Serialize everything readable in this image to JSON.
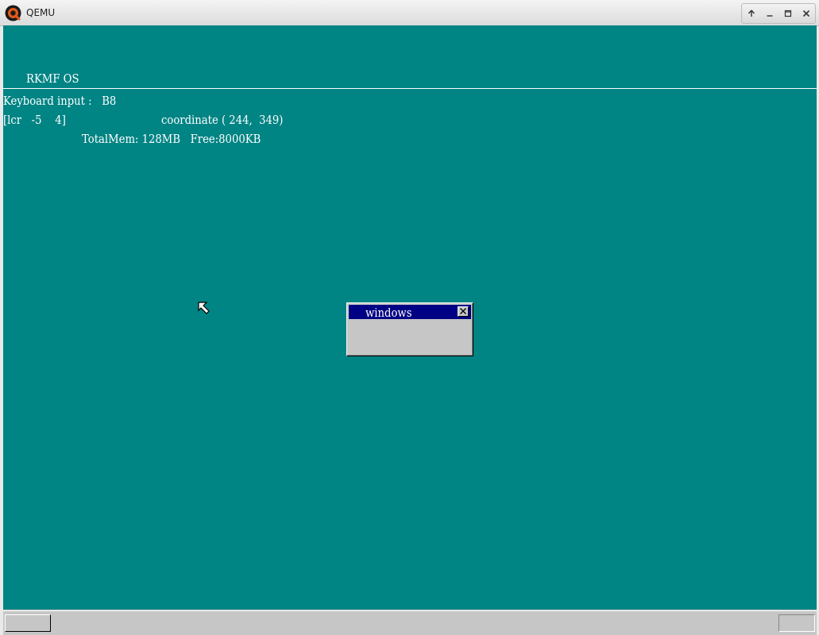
{
  "window": {
    "app_title": "QEMU",
    "controls": [
      "up-arrow-icon",
      "minimize-icon",
      "maximize-icon",
      "close-icon"
    ]
  },
  "os": {
    "title": "RKMF OS",
    "keyboard_line": "Keyboard input :   B8",
    "mouse_line": "[lcr   -5    4]",
    "coordinate_line": "coordinate ( 244,  349)",
    "memory_line": "TotalMem: 128MB   Free:8000KB",
    "window_title": "windows"
  },
  "colors": {
    "desktop": "#008484",
    "window_title_bar": "#000084",
    "panel": "#c6c6c6"
  }
}
